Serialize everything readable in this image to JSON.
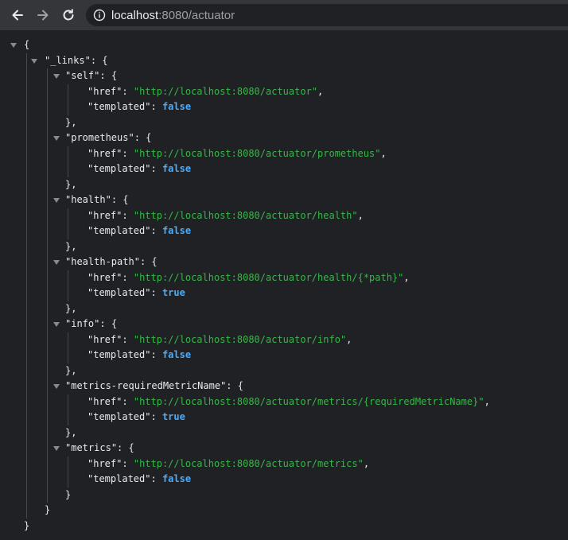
{
  "toolbar": {
    "back_icon": "arrow-left-icon",
    "forward_icon": "arrow-right-icon",
    "reload_icon": "reload-icon",
    "info_icon": "info-icon",
    "url_host": "localhost",
    "url_rest": ":8080/actuator"
  },
  "json": {
    "root_key": "_links",
    "links": [
      {
        "name": "self",
        "href": "http://localhost:8080/actuator",
        "templated": "false"
      },
      {
        "name": "prometheus",
        "href": "http://localhost:8080/actuator/prometheus",
        "templated": "false"
      },
      {
        "name": "health",
        "href": "http://localhost:8080/actuator/health",
        "templated": "false"
      },
      {
        "name": "health-path",
        "href": "http://localhost:8080/actuator/health/{*path}",
        "templated": "true"
      },
      {
        "name": "info",
        "href": "http://localhost:8080/actuator/info",
        "templated": "false"
      },
      {
        "name": "metrics-requiredMetricName",
        "href": "http://localhost:8080/actuator/metrics/{requiredMetricName}",
        "templated": "true"
      },
      {
        "name": "metrics",
        "href": "http://localhost:8080/actuator/metrics",
        "templated": "false"
      }
    ],
    "href_key": "href",
    "templated_key": "templated"
  },
  "colors": {
    "string": "#39b54a",
    "boolean": "#4dabf7",
    "background": "#202124"
  }
}
